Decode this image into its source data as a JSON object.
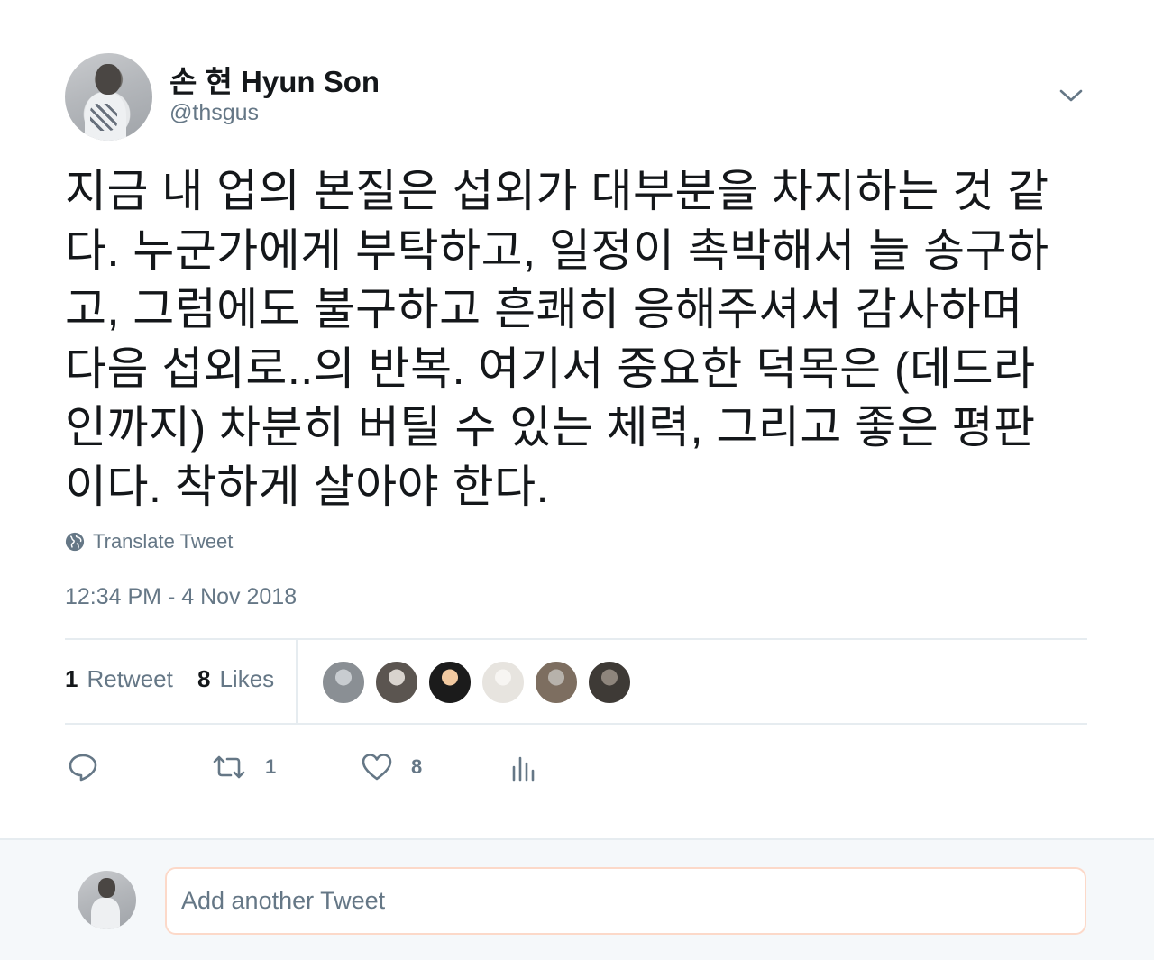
{
  "author": {
    "display_name": "손 현 Hyun Son",
    "handle": "@thsgus"
  },
  "tweet": {
    "text": "지금 내 업의 본질은 섭외가 대부분을 차지하는 것 같\n다. 누군가에게 부탁하고, 일정이 촉박해서 늘 송구하\n고, 그럼에도 불구하고 흔쾌히 응해주셔서 감사하며\n다음 섭외로..의 반복. 여기서 중요한 덕목은 (데드라\n인까지) 차분히 버틸 수 있는 체력, 그리고 좋은 평판\n이다. 착하게 살아야 한다.",
    "translate_label": "Translate Tweet",
    "timestamp": "12:34 PM - 4 Nov 2018"
  },
  "stats": {
    "retweet_count": "1",
    "retweet_label": "Retweet",
    "like_count": "8",
    "like_label": "Likes"
  },
  "likers": [
    {
      "icon": "liker-avatar-1",
      "color": "#8a8f94"
    },
    {
      "icon": "liker-avatar-2",
      "color": "#5b5550"
    },
    {
      "icon": "liker-avatar-3",
      "color": "#1b1b1b"
    },
    {
      "icon": "liker-avatar-4",
      "color": "#e7e4df"
    },
    {
      "icon": "liker-avatar-5",
      "color": "#7d6e60"
    },
    {
      "icon": "liker-avatar-6",
      "color": "#3e3a36"
    }
  ],
  "actions": {
    "reply_icon": "reply-icon",
    "retweet_icon": "retweet-icon",
    "retweet_count": "1",
    "like_icon": "heart-icon",
    "like_count": "8",
    "analytics_icon": "analytics-icon"
  },
  "reply": {
    "placeholder": "Add another Tweet"
  },
  "colors": {
    "text_primary": "#14171a",
    "text_secondary": "#657786",
    "divider": "#e6ecf0",
    "reply_bg": "#f5f8fa",
    "input_border": "#fcd9c9"
  }
}
